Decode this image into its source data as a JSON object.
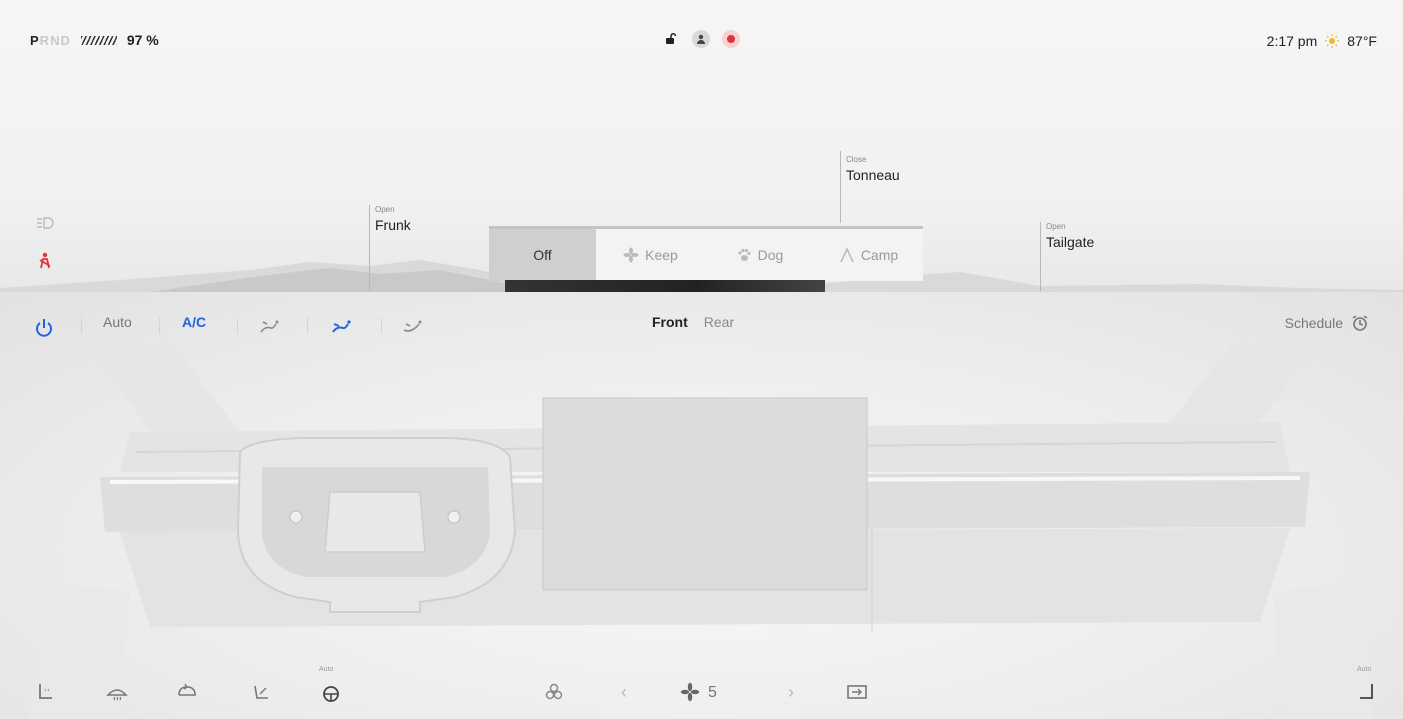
{
  "status": {
    "gears": [
      "P",
      "R",
      "N",
      "D"
    ],
    "active_gear": "P",
    "battery_percent": "97 %",
    "time": "2:17 pm",
    "temperature": "87°F"
  },
  "vehicle": {
    "frunk": {
      "action": "Open",
      "label": "Frunk"
    },
    "tonneau": {
      "action": "Close",
      "label": "Tonneau"
    },
    "tailgate": {
      "action": "Open",
      "label": "Tailgate"
    }
  },
  "modes": [
    {
      "label": "Off",
      "icon": "off",
      "selected": true
    },
    {
      "label": "Keep",
      "icon": "fan-icon",
      "selected": false
    },
    {
      "label": "Dog",
      "icon": "paw-icon",
      "selected": false
    },
    {
      "label": "Camp",
      "icon": "tent-icon",
      "selected": false
    }
  ],
  "climate": {
    "auto_label": "Auto",
    "ac_label": "A/C",
    "tabs": {
      "front": "Front",
      "rear": "Rear"
    },
    "schedule_label": "Schedule",
    "fan_speed": "5",
    "auto_small": "Auto"
  },
  "colors": {
    "accent": "#1e63e6",
    "alert": "#e0353b"
  }
}
